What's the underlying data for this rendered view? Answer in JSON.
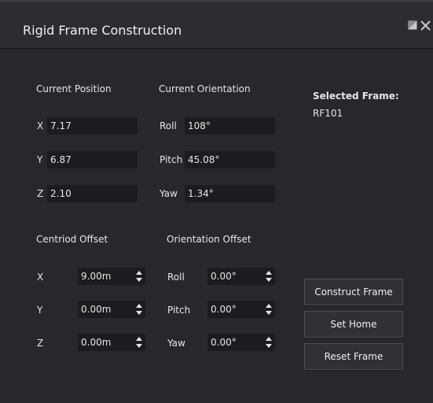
{
  "window": {
    "title": "Rigid Frame Construction"
  },
  "current_position": {
    "heading": "Current Position",
    "x_label": "X",
    "x_value": "7.17",
    "y_label": "Y",
    "y_value": "6.87",
    "z_label": "Z",
    "z_value": "2.10"
  },
  "current_orientation": {
    "heading": "Current Orientation",
    "roll_label": "Roll",
    "roll_value": "108°",
    "pitch_label": "Pitch",
    "pitch_value": "45.08°",
    "yaw_label": "Yaw",
    "yaw_value": "1.34°"
  },
  "selected": {
    "label": "Selected Frame:",
    "value": "RF101"
  },
  "centroid_offset": {
    "heading": "Centriod Offset",
    "x_label": "X",
    "x_value": "9.00m",
    "y_label": "Y",
    "y_value": "0.00m",
    "z_label": "Z",
    "z_value": "0.00m"
  },
  "orientation_offset": {
    "heading": "Orientation Offset",
    "roll_label": "Roll",
    "roll_value": "0.00°",
    "pitch_label": "Pitch",
    "pitch_value": "0.00°",
    "yaw_label": "Yaw",
    "yaw_value": "0.00°"
  },
  "buttons": {
    "construct": "Construct Frame",
    "set_home": "Set Home",
    "reset": "Reset Frame"
  },
  "colors": {
    "background": "#26282c",
    "field": "#1b1c1f",
    "text": "#e6e6e6"
  },
  "icons": {
    "restore": "restore-icon",
    "close": "close-icon",
    "spin": "spin-arrows-icon"
  }
}
